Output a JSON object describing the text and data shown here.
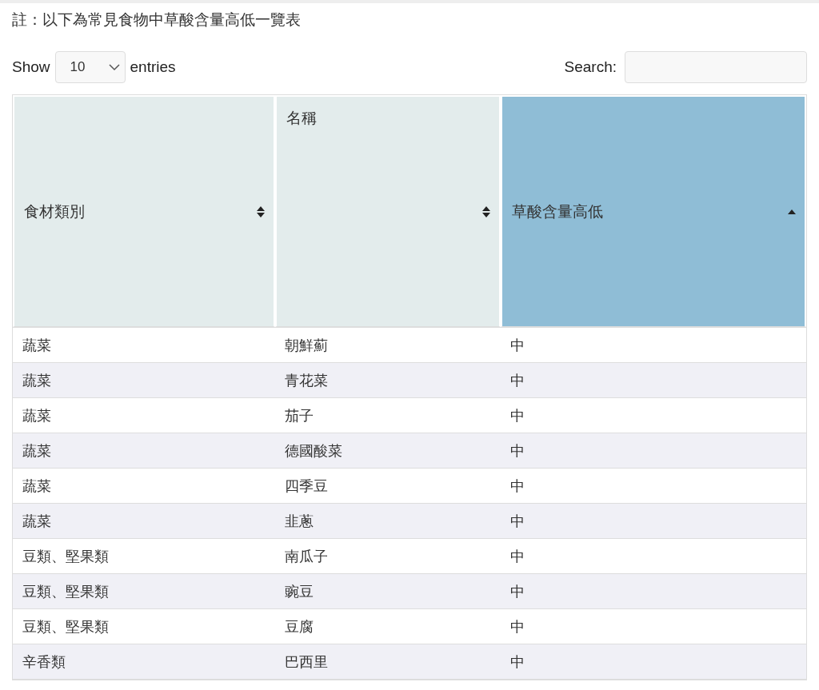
{
  "note": "註：以下為常見食物中草酸含量高低一覽表",
  "length_control": {
    "label_before": "Show",
    "value": "10",
    "label_after": "entries"
  },
  "search": {
    "label": "Search:"
  },
  "table": {
    "columns": [
      {
        "label": "食材類別",
        "sorted": false,
        "label_top": false
      },
      {
        "label": "名稱",
        "sorted": false,
        "label_top": true
      },
      {
        "label": "草酸含量高低",
        "sorted": true,
        "label_top": false
      }
    ],
    "rows": [
      [
        "蔬菜",
        "朝鮮薊",
        "中"
      ],
      [
        "蔬菜",
        "青花菜",
        "中"
      ],
      [
        "蔬菜",
        "茄子",
        "中"
      ],
      [
        "蔬菜",
        "德國酸菜",
        "中"
      ],
      [
        "蔬菜",
        "四季豆",
        "中"
      ],
      [
        "蔬菜",
        "韭蔥",
        "中"
      ],
      [
        "豆類、堅果類",
        "南瓜子",
        "中"
      ],
      [
        "豆類、堅果類",
        "豌豆",
        "中"
      ],
      [
        "豆類、堅果類",
        "豆腐",
        "中"
      ],
      [
        "辛香類",
        "巴西里",
        "中"
      ]
    ]
  }
}
